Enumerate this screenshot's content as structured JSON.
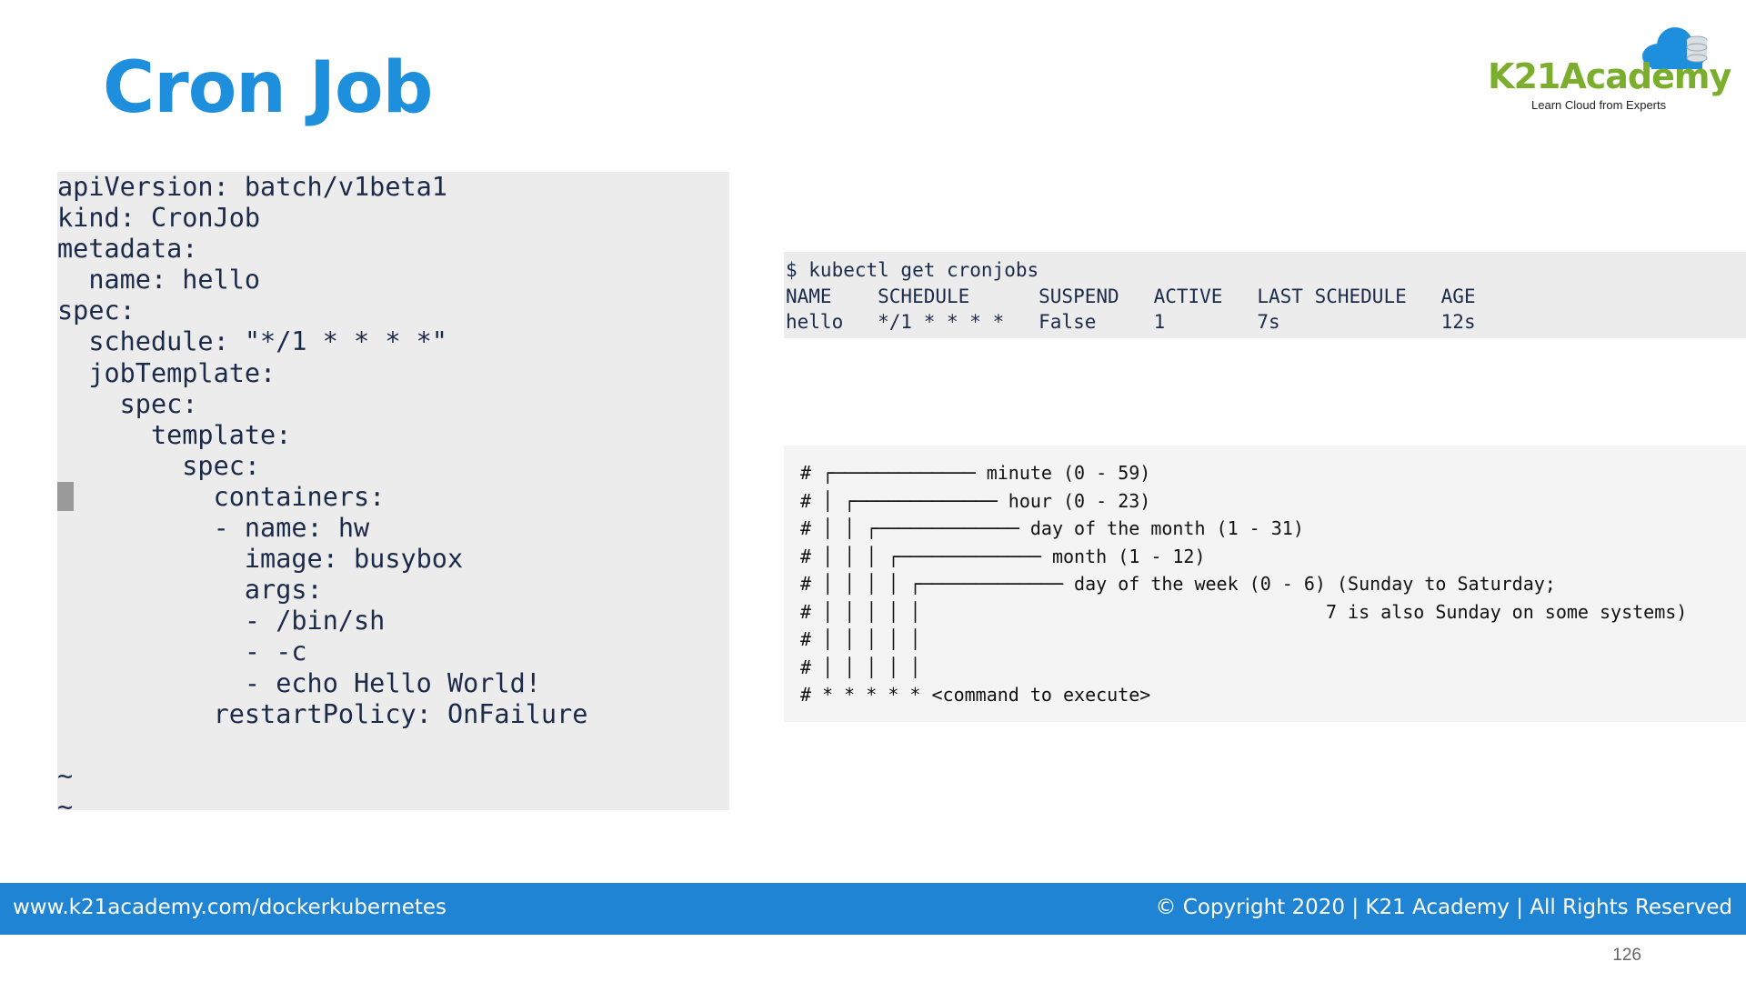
{
  "slide": {
    "title": "Cron Job",
    "page_number": "126"
  },
  "logo": {
    "brand": "K21Academy",
    "tagline": "Learn Cloud from Experts",
    "brand_color": "#7bae2c",
    "cloud_color": "#1e8fdc",
    "icon": "cloud-database-icon"
  },
  "yaml_editor": {
    "content": "apiVersion: batch/v1beta1\nkind: CronJob\nmetadata:\n  name: hello\nspec:\n  schedule: \"*/1 * * * *\"\n  jobTemplate:\n    spec:\n      template:\n        spec:\n          containers:\n          - name: hw\n            image: busybox\n            args:\n            - /bin/sh\n            - -c\n            - echo Hello World!\n          restartPolicy: OnFailure\n\n~\n~"
  },
  "kubectl_output": {
    "content": "$ kubectl get cronjobs\nNAME    SCHEDULE      SUSPEND   ACTIVE   LAST SCHEDULE   AGE\nhello   */1 * * * *   False     1        7s              12s"
  },
  "cron_syntax": {
    "content": "# ┌───────────── minute (0 - 59)\n# │ ┌───────────── hour (0 - 23)\n# │ │ ┌───────────── day of the month (1 - 31)\n# │ │ │ ┌───────────── month (1 - 12)\n# │ │ │ │ ┌───────────── day of the week (0 - 6) (Sunday to Saturday;\n# │ │ │ │ │                                     7 is also Sunday on some systems)\n# │ │ │ │ │\n# │ │ │ │ │\n# * * * * * <command to execute>"
  },
  "footer": {
    "url": "www.k21academy.com/dockerkubernetes",
    "copyright": "© Copyright 2020 | K21 Academy | All Rights Reserved",
    "background": "#1f84d4"
  },
  "colors": {
    "title": "#1e8fdc",
    "code_background": "#ececec",
    "code_text": "#1c2a4a"
  }
}
